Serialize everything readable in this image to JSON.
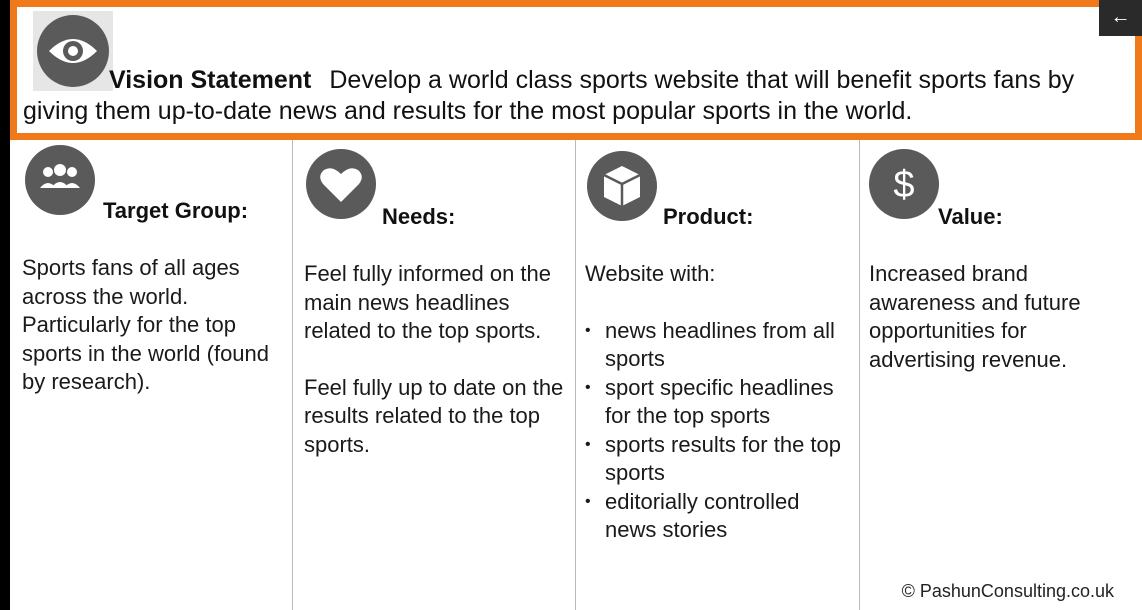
{
  "vision": {
    "icon": "eye-icon",
    "heading": "Vision Statement",
    "text": "Develop a world class sports website that will benefit sports fans by giving them up-to-date news and results for the most popular sports in the world."
  },
  "nav": {
    "back_icon": "arrow-left-icon",
    "back_glyph": "←"
  },
  "columns": [
    {
      "icon": "group-icon",
      "heading": "Target Group:",
      "paragraphs": [
        "Sports fans of all ages across the world. Particularly for the top sports in the world (found by research)."
      ]
    },
    {
      "icon": "heart-icon",
      "heading": "Needs:",
      "paragraphs": [
        "Feel fully informed on the main news headlines related to the top sports.",
        "Feel fully up to date on the results related to the top sports."
      ]
    },
    {
      "icon": "box-icon",
      "heading": "Product:",
      "intro": "Website with:",
      "bullets": [
        "news headlines from all sports",
        "sport specific headlines for the top sports",
        "sports results for the top sports",
        "editorially controlled news stories"
      ]
    },
    {
      "icon": "dollar-icon",
      "heading": "Value:",
      "icon_glyph": "$",
      "paragraphs": [
        "Increased brand awareness and future opportunities for advertising revenue."
      ]
    }
  ],
  "footer": {
    "copyright": "© PashunConsulting.co.uk"
  },
  "colors": {
    "accent_border": "#f07a1a",
    "icon_circle": "#5a5a5a"
  }
}
